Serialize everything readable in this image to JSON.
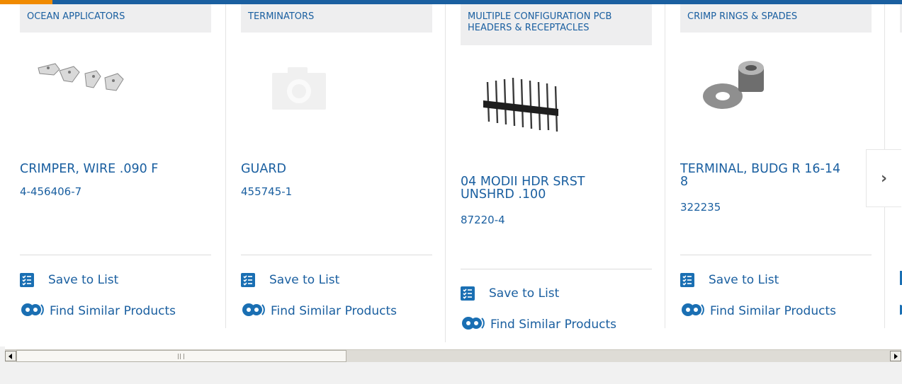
{
  "colors": {
    "brand": "#1a5fa0",
    "accent": "#f08a00",
    "category_bg": "#eeeeef"
  },
  "cards": [
    {
      "category": "OCEAN APPLICATORS",
      "title": "CRIMPER, WIRE .090 F",
      "part_number": "4-456406-7",
      "image": "applicator-blades-image"
    },
    {
      "category": "TERMINATORS",
      "title": "GUARD",
      "part_number": "455745-1",
      "image": "camera-placeholder-image"
    },
    {
      "category": "MULTIPLE CONFIGURATION PCB HEADERS & RECEPTACLES",
      "title": "04 MODII HDR SRST UNSHRD .100",
      "part_number": "87220-4",
      "image": "pin-header-image"
    },
    {
      "category": "CRIMP RINGS & SPADES",
      "title": "TERMINAL, BUDG R 16-14 8",
      "part_number": "322235",
      "image": "ring-terminal-image"
    }
  ],
  "actions": {
    "save": "Save to List",
    "similar": "Find Similar Products"
  },
  "icons": {
    "save": "checklist-icon",
    "similar": "gears-icon",
    "next": "chevron-right-icon"
  },
  "carousel": {
    "next_label": "›"
  }
}
